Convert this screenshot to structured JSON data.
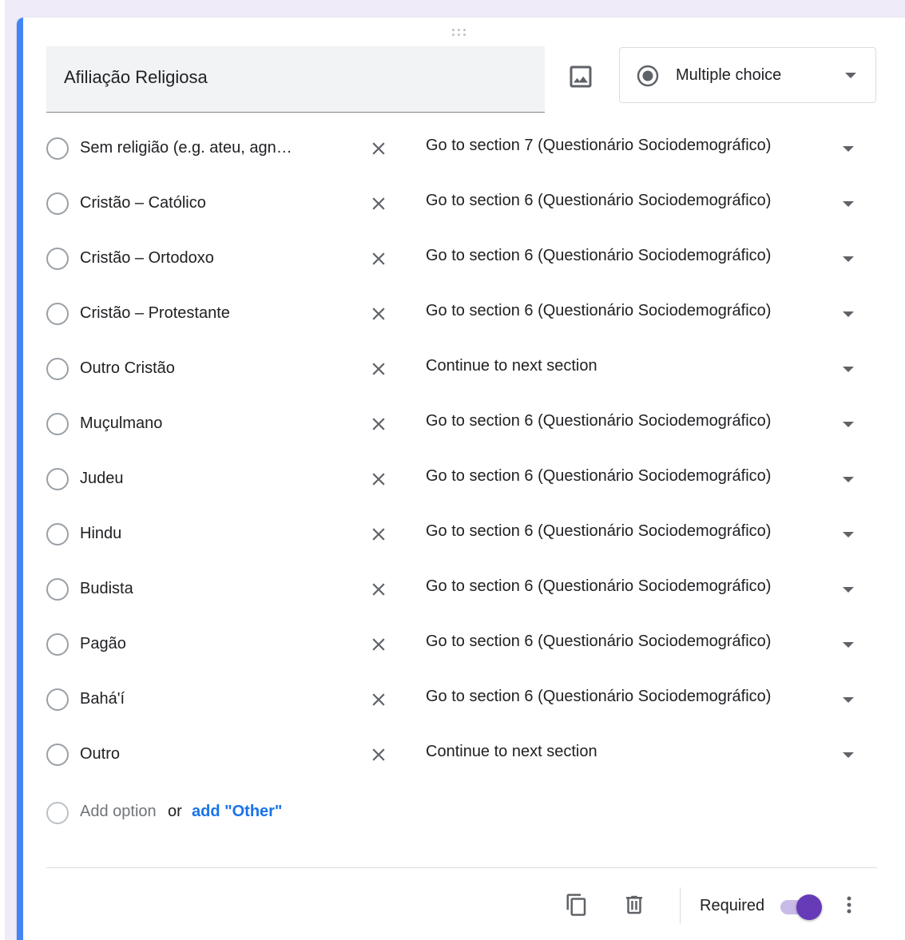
{
  "question": {
    "title": "Afiliação Religiosa",
    "type_label": "Multiple choice"
  },
  "options": [
    {
      "label": "Sem religião (e.g. ateu, agn…",
      "goto": "Go to section 7 (Questionário Sociodemográfico)"
    },
    {
      "label": "Cristão – Católico",
      "goto": "Go to section 6 (Questionário Sociodemográfico)"
    },
    {
      "label": "Cristão – Ortodoxo",
      "goto": "Go to section 6 (Questionário Sociodemográfico)"
    },
    {
      "label": "Cristão – Protestante",
      "goto": "Go to section 6 (Questionário Sociodemográfico)"
    },
    {
      "label": "Outro Cristão",
      "goto": "Continue to next section"
    },
    {
      "label": "Muçulmano",
      "goto": "Go to section 6 (Questionário Sociodemográfico)"
    },
    {
      "label": "Judeu",
      "goto": "Go to section 6 (Questionário Sociodemográfico)"
    },
    {
      "label": "Hindu",
      "goto": "Go to section 6 (Questionário Sociodemográfico)"
    },
    {
      "label": "Budista",
      "goto": "Go to section 6 (Questionário Sociodemográfico)"
    },
    {
      "label": "Pagão",
      "goto": "Go to section 6 (Questionário Sociodemográfico)"
    },
    {
      "label": "Bahá'í",
      "goto": "Go to section 6 (Questionário Sociodemográfico)"
    },
    {
      "label": "Outro",
      "goto": "Continue to next section"
    }
  ],
  "add": {
    "add_option": "Add option",
    "or": "or",
    "add_other": "add \"Other\""
  },
  "footer": {
    "required_label": "Required",
    "required_on": true
  },
  "colors": {
    "accent": "#4285f4",
    "toggle": "#673ab7",
    "link": "#1a73e8"
  }
}
